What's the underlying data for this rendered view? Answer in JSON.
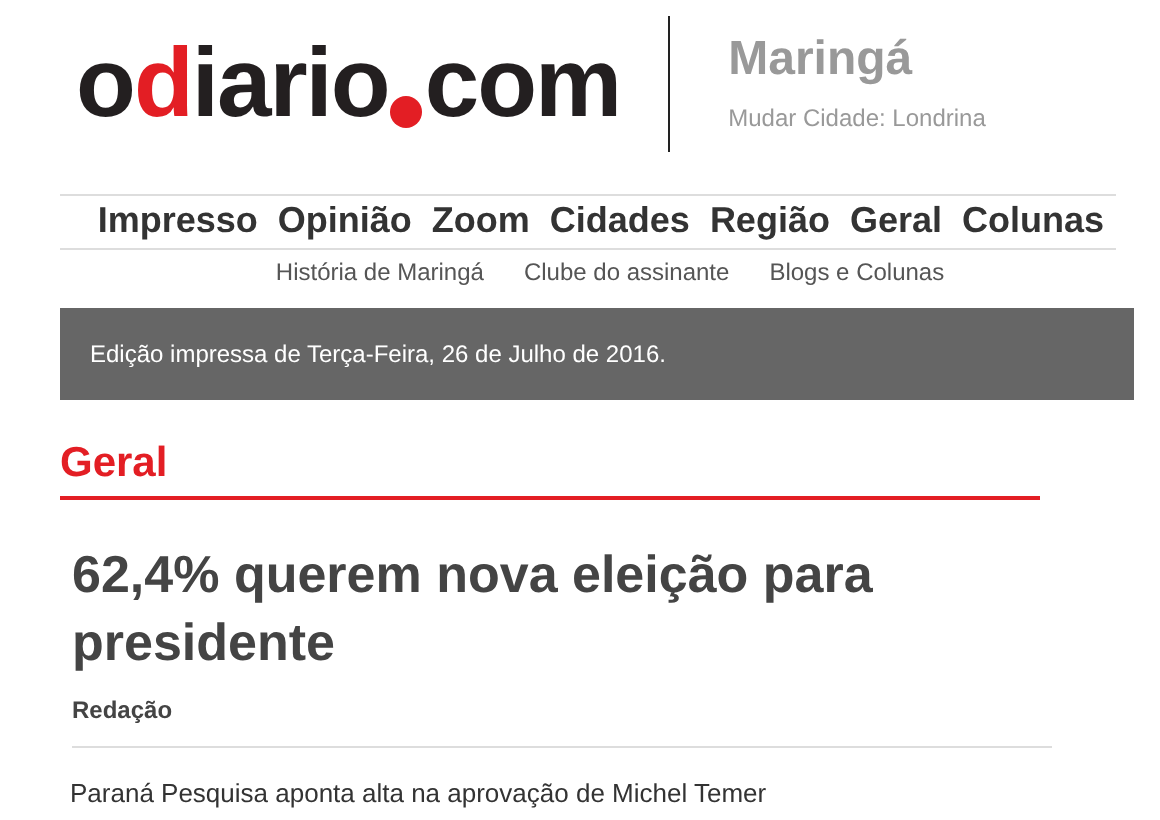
{
  "logo": {
    "segments": [
      {
        "kind": "text",
        "text": "o",
        "accent": false
      },
      {
        "kind": "text",
        "text": "d",
        "accent": true
      },
      {
        "kind": "text",
        "text": "iario",
        "accent": false
      },
      {
        "kind": "dot"
      },
      {
        "kind": "text",
        "text": "com",
        "accent": false
      }
    ]
  },
  "city": {
    "name": "Maringá",
    "change_link": "Mudar Cidade: Londrina"
  },
  "main_nav": [
    "Impresso",
    "Opinião",
    "Zoom",
    "Cidades",
    "Região",
    "Geral",
    "Colunas"
  ],
  "sub_nav": [
    "História de Maringá",
    "Clube do assinante",
    "Blogs e Colunas"
  ],
  "edition_banner": "Edição impressa de Terça-Feira, 26 de Julho de 2016.",
  "section_title": "Geral",
  "article": {
    "headline": "62,4% querem nova eleição para presidente",
    "author": "Redação",
    "lead": "Paraná Pesquisa aponta alta na aprovação de Michel Temer"
  }
}
